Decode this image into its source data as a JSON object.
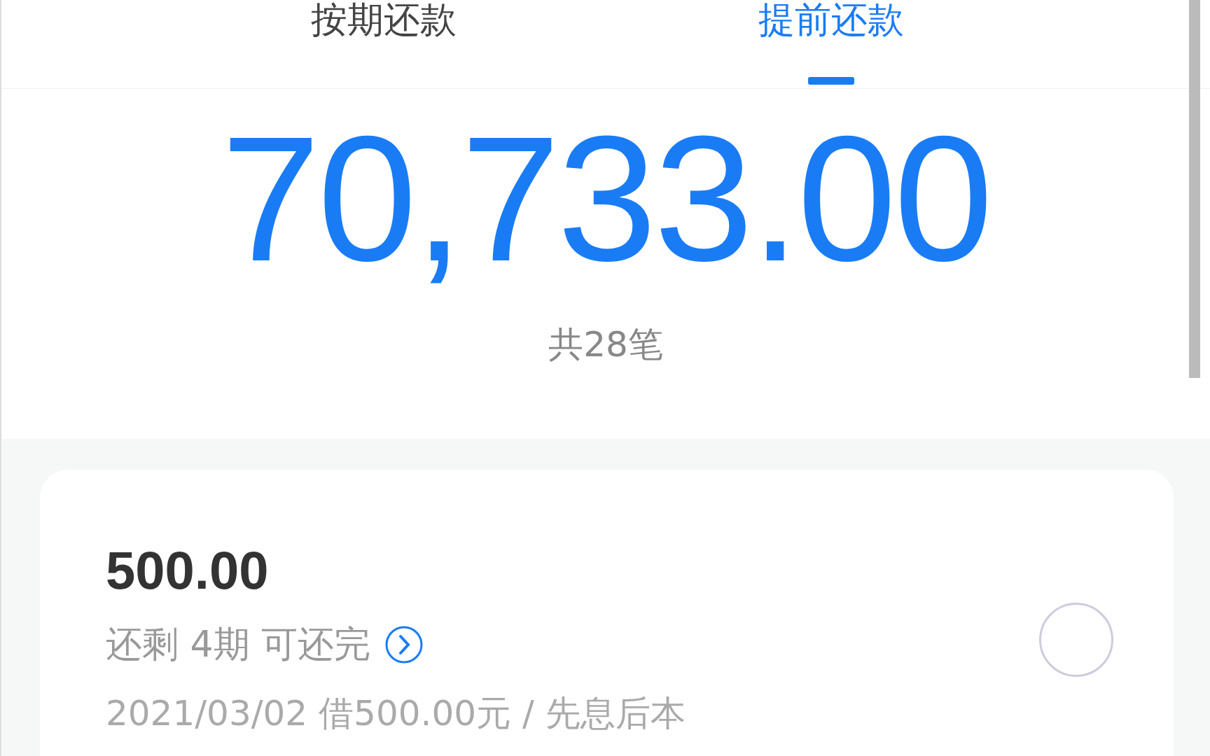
{
  "tabs": [
    {
      "label": "按期还款",
      "selected": false
    },
    {
      "label": "提前还款",
      "selected": true
    }
  ],
  "summary": {
    "amount": "70,733.00",
    "count": "共28笔"
  },
  "loans": [
    {
      "amount": "500.00",
      "remaining": "还剩 4期 可还完",
      "detail": "2021/03/02 借500.00元 / 先息后本",
      "checked": false
    }
  ]
}
